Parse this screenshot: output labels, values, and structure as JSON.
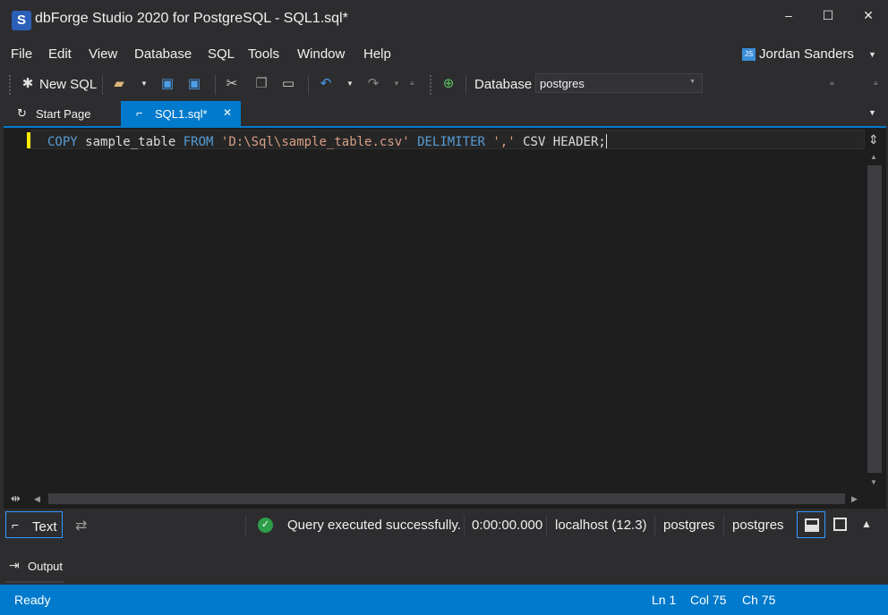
{
  "window": {
    "title": "dbForge Studio 2020 for PostgreSQL - SQL1.sql*",
    "logo_letter": "S",
    "controls": {
      "minimize": "–",
      "maximize": "☐",
      "close": "✕"
    }
  },
  "menu": {
    "items": [
      "File",
      "Edit",
      "View",
      "Database",
      "SQL",
      "Tools",
      "Window",
      "Help"
    ]
  },
  "user": {
    "initials": "JS",
    "name": "Jordan Sanders"
  },
  "toolbar": {
    "new_sql_label": "New SQL",
    "database_label": "Database",
    "database_value": "postgres"
  },
  "tabs": {
    "start_page": "Start Page",
    "active": "SQL1.sql*",
    "close_glyph": "✕"
  },
  "editor": {
    "tokens": {
      "copy": "COPY",
      "table": "sample_table",
      "from": "FROM",
      "path": "'D:\\Sql\\sample_table.csv'",
      "delimiter": "DELIMITER",
      "delim_value": "','",
      "tail": "CSV HEADER;"
    }
  },
  "result_bar": {
    "text_button": "Text",
    "message": "Query executed successfully.",
    "elapsed": "0:00:00.000",
    "server": "localhost (12.3)",
    "database": "postgres",
    "user": "postgres"
  },
  "output_tab": {
    "label": "Output"
  },
  "status": {
    "state": "Ready",
    "line": "Ln 1",
    "column": "Col 75",
    "char": "Ch 75"
  },
  "colors": {
    "accent": "#007acc",
    "background": "#2d2d30",
    "editor_background": "#1e1e1e",
    "keyword": "#569cd6",
    "string": "#d69d85",
    "success": "#2e9e48",
    "modified_line_marker": "#ffeb00"
  },
  "icons": {
    "new_sql": "new-sql-icon",
    "open": "open-folder-icon",
    "save": "save-icon",
    "save_all": "save-all-icon",
    "cut": "cut-icon",
    "copy": "copy-icon",
    "paste": "paste-icon",
    "undo": "undo-icon",
    "redo": "redo-icon",
    "connect": "connect-plug-icon",
    "success": "check-circle-icon"
  }
}
